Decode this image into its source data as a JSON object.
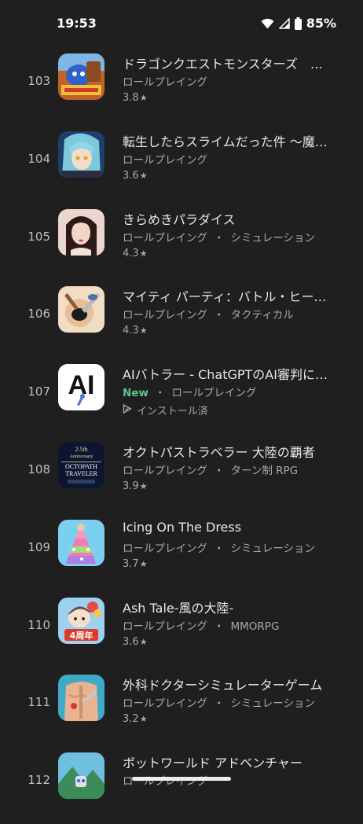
{
  "status_bar": {
    "time": "19:53",
    "battery": "85%",
    "icons": [
      "wifi-icon",
      "cell-signal-icon",
      "battery-icon"
    ]
  },
  "apps": [
    {
      "rank": "103",
      "title": "ドラゴンクエストモンスターズ　…",
      "category": "ロールプレイング",
      "tag": "",
      "rating": "3.8",
      "icon": "dragon-quest-monsters-icon"
    },
    {
      "rank": "104",
      "title": "転生したらスライムだった件 〜魔…",
      "category": "ロールプレイング",
      "tag": "",
      "rating": "3.6",
      "icon": "tensura-icon"
    },
    {
      "rank": "105",
      "title": "きらめきパラダイス",
      "category": "ロールプレイング",
      "tag": "シミュレーション",
      "rating": "4.3",
      "icon": "kirameki-paradise-icon"
    },
    {
      "rank": "106",
      "title": "マイティ パーティ：バトル・ヒー…",
      "category": "ロールプレイング",
      "tag": "タクティカル",
      "rating": "4.3",
      "icon": "mighty-party-icon"
    },
    {
      "rank": "107",
      "title": "AIバトラー - ChatGPTのAI審判に…",
      "new": "New",
      "category": "ロールプレイング",
      "tag": "",
      "installed": "インストール済",
      "icon": "ai-battler-icon"
    },
    {
      "rank": "108",
      "title": "オクトパストラベラー 大陸の覇者",
      "category": "ロールプレイング",
      "tag": "ターン制 RPG",
      "rating": "3.9",
      "icon": "octopath-traveler-icon"
    },
    {
      "rank": "109",
      "title": "Icing On The Dress",
      "category": "ロールプレイング",
      "tag": "シミュレーション",
      "rating": "3.7",
      "icon": "icing-on-the-dress-icon"
    },
    {
      "rank": "110",
      "title": "Ash Tale-風の大陸-",
      "category": "ロールプレイング",
      "tag": "MMORPG",
      "rating": "3.6",
      "icon": "ash-tale-icon"
    },
    {
      "rank": "111",
      "title": "外科ドクターシミュレーターゲーム",
      "category": "ロールプレイング",
      "tag": "シミュレーション",
      "rating": "3.2",
      "icon": "surgery-doctor-icon"
    },
    {
      "rank": "112",
      "title": "ボットワールド アドベンチャー",
      "category": "ロールプレイング",
      "tag": "",
      "rating": "",
      "icon": "botworld-adventure-icon"
    }
  ],
  "icon_text": {
    "ai_battler": "AI",
    "octopath_line1": "2.5th",
    "octopath_line2": "Anniversary",
    "octopath_line3": "OCTOPATH",
    "octopath_line4": "TRAVELER",
    "ash_tale": "4周年"
  },
  "separator": "・",
  "star": "★",
  "colors": {
    "background": "#1f1f1f",
    "new_badge": "#5ec28f",
    "text_secondary": "#a8a8a8"
  }
}
